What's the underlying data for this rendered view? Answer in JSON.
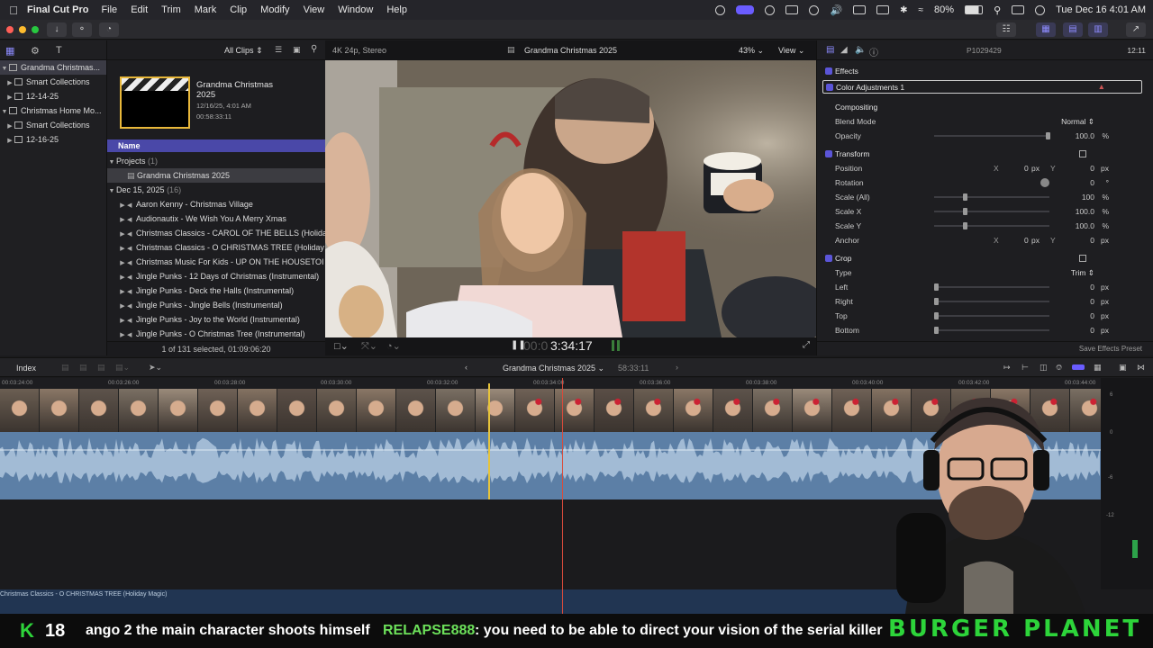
{
  "menubar": {
    "app_name": "Final Cut Pro",
    "menus": [
      "File",
      "Edit",
      "Trim",
      "Mark",
      "Clip",
      "Modify",
      "View",
      "Window",
      "Help"
    ],
    "battery": "80%",
    "clock": "Tue Dec 16  4:01 AM"
  },
  "library": {
    "items": [
      {
        "label": "Grandma Christmas...",
        "indent": 0,
        "selected": true
      },
      {
        "label": "Smart Collections",
        "indent": 1,
        "selected": false
      },
      {
        "label": "12-14-25",
        "indent": 1,
        "selected": false
      },
      {
        "label": "Christmas Home Mo...",
        "indent": 0,
        "selected": false
      },
      {
        "label": "Smart Collections",
        "indent": 1,
        "selected": false
      },
      {
        "label": "12-16-25",
        "indent": 1,
        "selected": false
      }
    ]
  },
  "browser": {
    "filter": "All Clips",
    "project_title": "Grandma Christmas 2025",
    "project_date": "12/16/25, 4:01 AM",
    "project_duration": "00:58:33:11",
    "column_name": "Name",
    "projects_label": "Projects",
    "projects_count": "(1)",
    "project_row": "Grandma Christmas 2025",
    "date_group": "Dec 15, 2025",
    "date_count": "(16)",
    "clips": [
      "Aaron Kenny - Christmas Village",
      "Audionautix - We Wish You A Merry Xmas",
      "Christmas Classics - CAROL OF THE BELLS (Holida",
      "Christmas Classics - O CHRISTMAS TREE (Holiday",
      "Christmas Music For Kids - UP ON THE HOUSETOI",
      "Jingle Punks - 12 Days of Christmas (Instrumental)",
      "Jingle Punks - Deck the Halls (Instrumental)",
      "Jingle Punks - Jingle Bells (Instrumental)",
      "Jingle Punks - Joy to the World (Instrumental)",
      "Jingle Punks - O Christmas Tree (Instrumental)"
    ],
    "footer": "1 of 131 selected, 01:09:06:20"
  },
  "viewer": {
    "format": "4K 24p, Stereo",
    "title": "Grandma Christmas 2025",
    "zoom": "43%",
    "view_label": "View",
    "timecode_dim": "00:0",
    "timecode": "3:34:17"
  },
  "inspector": {
    "clip_id": "P1029429",
    "duration": "12:11",
    "effects_label": "Effects",
    "effect_name": "Color Adjustments 1",
    "compositing_label": "Compositing",
    "blend_mode_label": "Blend Mode",
    "blend_mode_value": "Normal",
    "opacity_label": "Opacity",
    "opacity_value": "100.0",
    "transform_label": "Transform",
    "position_label": "Position",
    "position_x_label": "X",
    "position_x": "0",
    "position_y_label": "Y",
    "position_y": "0",
    "rotation_label": "Rotation",
    "rotation_value": "0",
    "scale_all_label": "Scale (All)",
    "scale_all_value": "100",
    "scale_x_label": "Scale X",
    "scale_x_value": "100.0",
    "scale_y_label": "Scale Y",
    "scale_y_value": "100.0",
    "anchor_label": "Anchor",
    "anchor_x": "0",
    "anchor_y": "0",
    "crop_label": "Crop",
    "type_label": "Type",
    "type_value": "Trim",
    "left_label": "Left",
    "left_value": "0",
    "right_label": "Right",
    "right_value": "0",
    "top_label": "Top",
    "top_value": "0",
    "bottom_label": "Bottom",
    "bottom_value": "0",
    "unit_px": "px",
    "unit_pct": "%",
    "unit_deg": "°",
    "save_preset": "Save Effects Preset"
  },
  "timeline": {
    "index_label": "Index",
    "project_title": "Grandma Christmas 2025",
    "duration": "58:33:11",
    "ruler_ticks": [
      "00:03:24:00",
      "00:03:26:00",
      "00:03:28:00",
      "00:03:30:00",
      "00:03:32:00",
      "00:03:34:00",
      "00:03:36:00",
      "00:03:38:00",
      "00:03:40:00",
      "00:03:42:00",
      "00:03:44:00"
    ],
    "music_clip": "Christmas Classics - O CHRISTMAS TREE (Holiday Magic)",
    "meter_labels": [
      "6",
      "0",
      "-6",
      "-12"
    ]
  },
  "ticker": {
    "count": "18",
    "message_prefix": "ango 2 the main character shoots himself",
    "user": "RELAPSE888",
    "message": ": you need to be able to direct your vision of the serial killer",
    "brand": "BURGER PLANET"
  }
}
